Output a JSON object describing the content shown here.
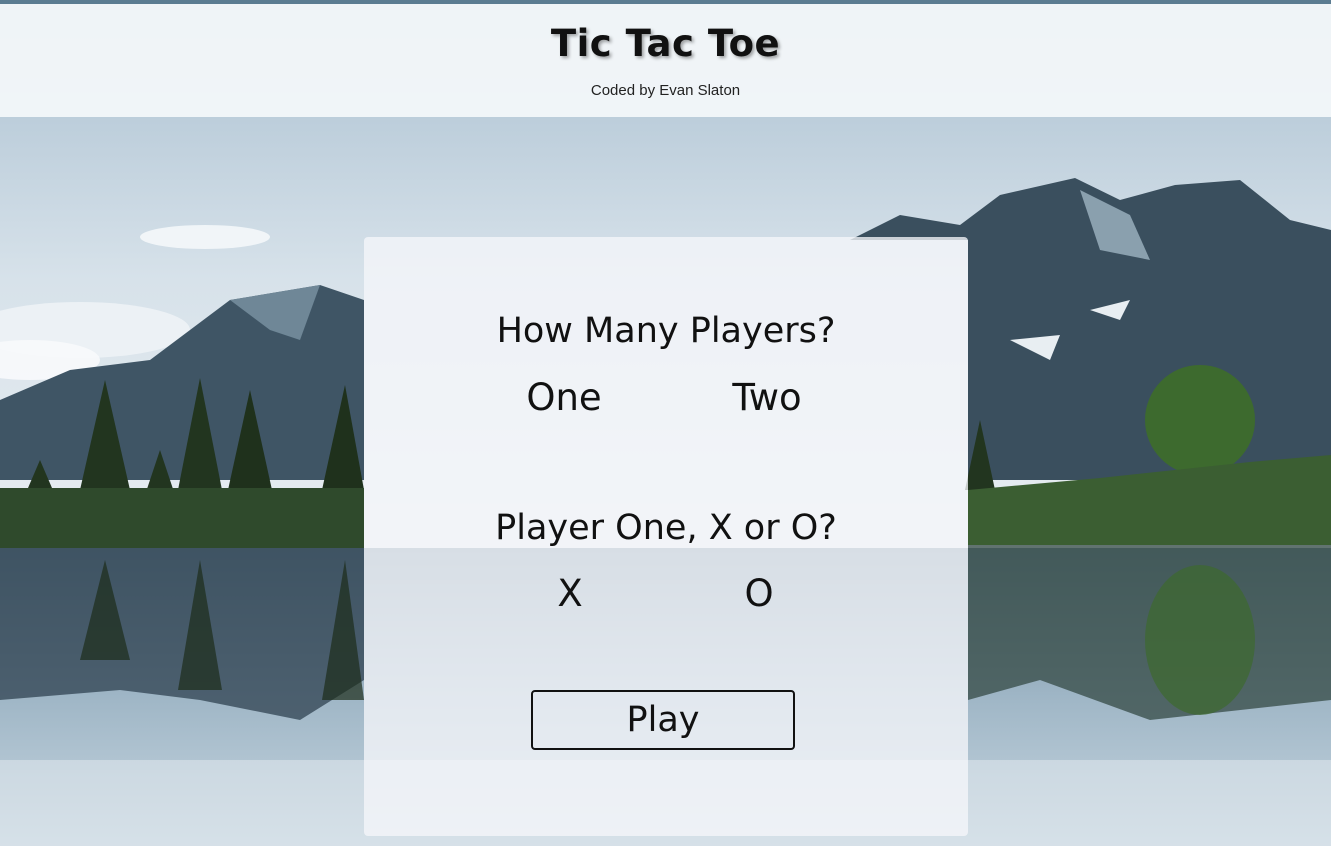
{
  "header": {
    "title": "Tic Tac Toe",
    "byline": "Coded by Evan Slaton"
  },
  "setup": {
    "players_question": "How Many Players?",
    "players_options": [
      "One",
      "Two"
    ],
    "mark_question": "Player One, X or O?",
    "mark_options": [
      "X",
      "O"
    ],
    "play_label": "Play"
  },
  "colors": {
    "text": "#111111",
    "header_bg": "#f4f8fa",
    "panel_bg": "#f5f6fa",
    "sky": "#c9d8e4",
    "mountain": "#3f5565",
    "forest": "#2f4a2c",
    "water": "#8fa9bb"
  }
}
